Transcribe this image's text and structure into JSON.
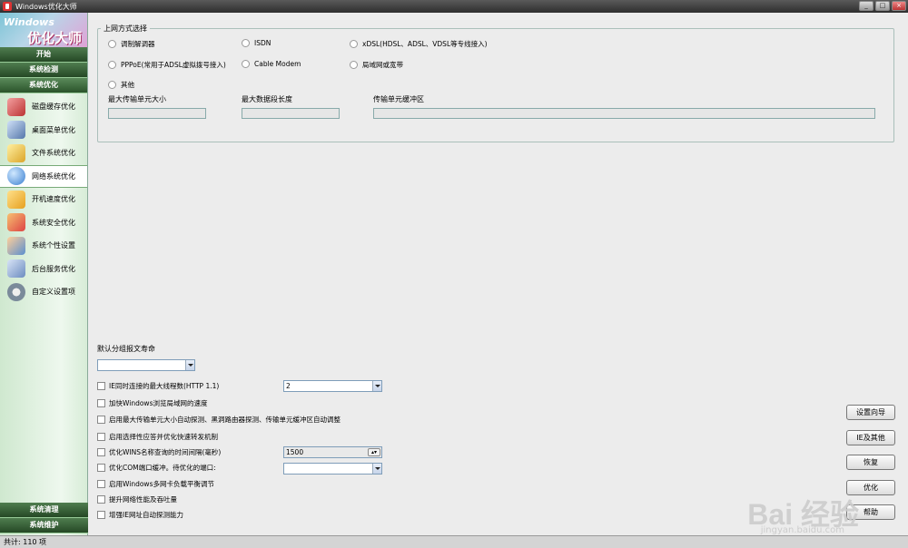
{
  "window": {
    "title": "Windows优化大师",
    "buttons": [
      "_",
      "□",
      "×"
    ]
  },
  "logo": {
    "line1": "Windows",
    "line2": "优化大师"
  },
  "sidebar": {
    "headers": [
      "开始",
      "系统检测",
      "系统优化"
    ],
    "items": [
      {
        "label": "磁盘缓存优化",
        "icon": "disk-icon",
        "color": "#c44"
      },
      {
        "label": "桌面菜单优化",
        "icon": "desktop-icon",
        "color": "#57a"
      },
      {
        "label": "文件系统优化",
        "icon": "folder-icon",
        "color": "#dba52a"
      },
      {
        "label": "网络系统优化",
        "icon": "globe-icon",
        "color": "#3a7fd0"
      },
      {
        "label": "开机速度优化",
        "icon": "speed-icon",
        "color": "#e6a020"
      },
      {
        "label": "系统安全优化",
        "icon": "security-icon",
        "color": "#d44"
      },
      {
        "label": "系统个性设置",
        "icon": "users-icon",
        "color": "#5b8fcf"
      },
      {
        "label": "后台服务优化",
        "icon": "service-icon",
        "color": "#6c8cc0"
      },
      {
        "label": "自定义设置项",
        "icon": "gear-icon",
        "color": "#7a8a9a"
      }
    ],
    "footer_headers": [
      "系统清理",
      "系统维护"
    ]
  },
  "network": {
    "group_title": "上网方式选择",
    "radios": [
      "调制解调器",
      "ISDN",
      "xDSL(HDSL、ADSL、VDSL等专线接入)",
      "PPPoE(常用于ADSL虚拟拨号接入)",
      "Cable Modem",
      "局域网或宽带",
      "其他"
    ],
    "field_labels": [
      "最大传输单元大小",
      "最大数据段长度",
      "传输单元缓冲区"
    ]
  },
  "settings": {
    "ttl_label": "默认分组报文寿命",
    "ttl_value": "",
    "checkboxes": [
      "IE同时连接的最大线程数(HTTP 1.1)",
      "加快Windows浏览局域网的速度",
      "启用最大传输单元大小自动探测、黑洞路由器探测、传输单元缓冲区自动调整",
      "启用选择性应答并优化快速转发机制",
      "优化WINS名称查询的时间间隔(毫秒)",
      "优化COM端口缓冲。待优化的端口:",
      "启用Windows多网卡负载平衡调节",
      "提升网络性能及吞吐量",
      "增强IE网址自动探测能力"
    ],
    "threads_value": "2",
    "wins_value": "1500",
    "com_value": ""
  },
  "buttons": [
    "设置向导",
    "IE及其他",
    "恢复",
    "优化",
    "帮助"
  ],
  "status": {
    "text": "共计: 110 项"
  },
  "watermark": {
    "text": "Bai 经验",
    "sub": "jingyan.baidu.com"
  }
}
